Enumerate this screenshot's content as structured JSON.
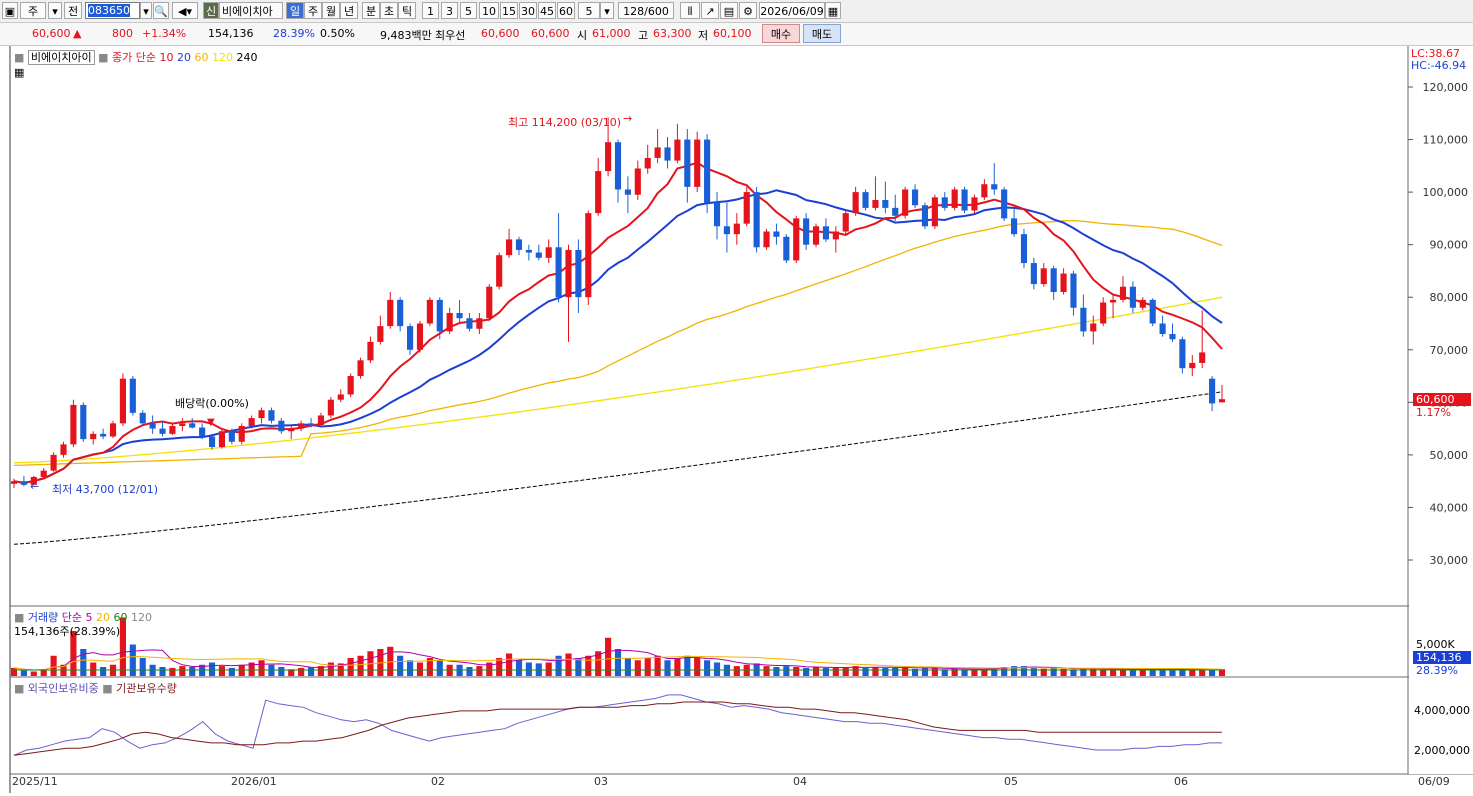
{
  "toolbar": {
    "type_label": "주",
    "market_label": "전",
    "code": "083650",
    "stock_badge": "신",
    "stock_name": "비에이치아",
    "periods": [
      "일",
      "주",
      "월",
      "년",
      "분",
      "초",
      "틱"
    ],
    "minute_options": [
      "1",
      "3",
      "5",
      "10",
      "15",
      "30",
      "45",
      "60"
    ],
    "count_select": "5",
    "bar_count": "128/600",
    "date": "2026/06/09"
  },
  "quote": {
    "price": "60,600",
    "change": "800",
    "change_pct": "+1.34%",
    "volume": "154,136",
    "turnover_pct": "28.39%",
    "ratio": "0.50%",
    "amount": "9,483백만",
    "bid_label": "최우선",
    "bid1": "60,600",
    "bid2": "60,600",
    "open_label": "시",
    "open": "61,000",
    "high_label": "고",
    "high": "63,300",
    "low_label": "저",
    "low": "60,100",
    "buy_label": "매수",
    "sell_label": "매도"
  },
  "price_legend": {
    "name": "비에이치아이",
    "title": "종가 단순",
    "ma": [
      "10",
      "20",
      "60",
      "120",
      "240"
    ],
    "ma_colors": [
      "#e4131c",
      "#1b3fd2",
      "#f0b400",
      "#f5e100",
      "#000000"
    ]
  },
  "right_info": {
    "lc": "LC:38.67",
    "hc": "HC:-46.94"
  },
  "annotations": {
    "high": "최고 114,200 (03/10)",
    "low": "최저 43,700 (12/01)",
    "dividend": "배당락(0.00%)"
  },
  "price_axis": [
    "120,000",
    "110,000",
    "100,000",
    "90,000",
    "80,000",
    "70,000",
    "60,000",
    "50,000",
    "40,000",
    "30,000"
  ],
  "current_tag": {
    "price": "60,600",
    "pct": "1.17%"
  },
  "volume_legend": {
    "title": "거래량",
    "ma_title": "단순",
    "ma": [
      "5",
      "20",
      "60",
      "120"
    ],
    "value": "154,136주(28.39%)"
  },
  "volume_axis": {
    "label": "5,000K",
    "current": "154,136",
    "pct": "28.39%"
  },
  "holding_legend": {
    "a": "외국인보유비중",
    "b": "기관보유수량"
  },
  "holding_axis": [
    "4,000,000",
    "2,000,000"
  ],
  "x_axis": [
    "2025/11",
    "2026/01",
    "02",
    "03",
    "04",
    "05",
    "06",
    "06/09"
  ],
  "chart_data": {
    "type": "candlestick",
    "ylim": [
      25000,
      125000
    ],
    "candles": [
      [
        44500,
        45500,
        43700,
        45000
      ],
      [
        45000,
        46000,
        44000,
        44300
      ],
      [
        44300,
        46000,
        44200,
        45800
      ],
      [
        45800,
        47500,
        45500,
        47000
      ],
      [
        47000,
        50500,
        46800,
        50000
      ],
      [
        50000,
        52500,
        49500,
        52000
      ],
      [
        52000,
        60500,
        51500,
        59500
      ],
      [
        59500,
        60000,
        52500,
        53000
      ],
      [
        53000,
        54500,
        52000,
        54000
      ],
      [
        54000,
        55000,
        53000,
        53500
      ],
      [
        53500,
        56500,
        53200,
        56000
      ],
      [
        56000,
        65500,
        55500,
        64500
      ],
      [
        64500,
        65000,
        57500,
        58000
      ],
      [
        58000,
        58500,
        55500,
        56000
      ],
      [
        56000,
        57500,
        54000,
        55000
      ],
      [
        55000,
        56500,
        53500,
        54000
      ],
      [
        54000,
        56000,
        53800,
        55500
      ],
      [
        55500,
        57000,
        54500,
        56000
      ],
      [
        56000,
        57000,
        55000,
        55200
      ],
      [
        55200,
        56000,
        53000,
        53500
      ],
      [
        53500,
        54000,
        51000,
        51500
      ],
      [
        51500,
        55000,
        51200,
        54500
      ],
      [
        54500,
        55000,
        52000,
        52500
      ],
      [
        52500,
        56000,
        52000,
        55500
      ],
      [
        55500,
        57500,
        55000,
        57000
      ],
      [
        57000,
        59000,
        56000,
        58500
      ],
      [
        58500,
        59000,
        56000,
        56500
      ],
      [
        56500,
        57000,
        54000,
        54500
      ],
      [
        54500,
        55500,
        53000,
        55000
      ],
      [
        55000,
        56500,
        54500,
        56000
      ],
      [
        56000,
        57000,
        55200,
        55700
      ],
      [
        55700,
        58000,
        55500,
        57500
      ],
      [
        57500,
        61000,
        57000,
        60500
      ],
      [
        60500,
        62500,
        60000,
        61500
      ],
      [
        61500,
        65500,
        61000,
        65000
      ],
      [
        65000,
        68500,
        64500,
        68000
      ],
      [
        68000,
        72500,
        67500,
        71500
      ],
      [
        71500,
        76500,
        71000,
        74500
      ],
      [
        74500,
        81000,
        74000,
        79500
      ],
      [
        79500,
        80000,
        73500,
        74500
      ],
      [
        74500,
        75000,
        69000,
        70000
      ],
      [
        70000,
        75500,
        69500,
        75000
      ],
      [
        75000,
        80000,
        74500,
        79500
      ],
      [
        79500,
        80000,
        72000,
        73500
      ],
      [
        73500,
        78000,
        73000,
        77000
      ],
      [
        77000,
        79500,
        75000,
        76000
      ],
      [
        76000,
        77000,
        73500,
        74000
      ],
      [
        74000,
        77000,
        73000,
        76000
      ],
      [
        76000,
        82500,
        75500,
        82000
      ],
      [
        82000,
        88500,
        81500,
        88000
      ],
      [
        88000,
        93000,
        87500,
        91000
      ],
      [
        91000,
        91500,
        88000,
        89000
      ],
      [
        89000,
        90000,
        87000,
        88500
      ],
      [
        88500,
        90000,
        87000,
        87500
      ],
      [
        87500,
        91000,
        86500,
        89500
      ],
      [
        89500,
        96000,
        79000,
        80000
      ],
      [
        80000,
        90000,
        71500,
        89000
      ],
      [
        89000,
        91000,
        77000,
        80000
      ],
      [
        80000,
        96500,
        78500,
        96000
      ],
      [
        96000,
        106500,
        95500,
        104000
      ],
      [
        104000,
        114200,
        103000,
        109500
      ],
      [
        109500,
        110000,
        98000,
        100500
      ],
      [
        100500,
        103000,
        96000,
        99500
      ],
      [
        99500,
        106000,
        98500,
        104500
      ],
      [
        104500,
        109000,
        103500,
        106500
      ],
      [
        106500,
        112000,
        105500,
        108500
      ],
      [
        108500,
        110500,
        104500,
        106000
      ],
      [
        106000,
        113000,
        105500,
        110000
      ],
      [
        110000,
        112000,
        98000,
        101000
      ],
      [
        101000,
        111500,
        100000,
        110000
      ],
      [
        110000,
        111000,
        96000,
        98000
      ],
      [
        98000,
        100000,
        91000,
        93500
      ],
      [
        93500,
        98000,
        88500,
        92000
      ],
      [
        92000,
        96000,
        90000,
        94000
      ],
      [
        94000,
        101000,
        93500,
        100000
      ],
      [
        100000,
        101000,
        88500,
        89500
      ],
      [
        89500,
        93000,
        89000,
        92500
      ],
      [
        92500,
        94000,
        90000,
        91500
      ],
      [
        91500,
        92000,
        86500,
        87000
      ],
      [
        87000,
        95500,
        86500,
        95000
      ],
      [
        95000,
        96000,
        89000,
        90000
      ],
      [
        90000,
        94000,
        89500,
        93500
      ],
      [
        93500,
        95000,
        90500,
        91000
      ],
      [
        91000,
        93500,
        88500,
        92500
      ],
      [
        92500,
        96500,
        92000,
        96000
      ],
      [
        96000,
        101000,
        95500,
        100000
      ],
      [
        100000,
        100500,
        96500,
        97000
      ],
      [
        97000,
        103000,
        96500,
        98500
      ],
      [
        98500,
        102000,
        96000,
        97000
      ],
      [
        97000,
        99500,
        94500,
        95500
      ],
      [
        95500,
        101000,
        95000,
        100500
      ],
      [
        100500,
        101500,
        97000,
        97500
      ],
      [
        97500,
        98000,
        93000,
        93500
      ],
      [
        93500,
        99500,
        93000,
        99000
      ],
      [
        99000,
        100000,
        96500,
        97000
      ],
      [
        97000,
        101000,
        96500,
        100500
      ],
      [
        100500,
        101000,
        96000,
        96500
      ],
      [
        96500,
        99500,
        96000,
        99000
      ],
      [
        99000,
        102500,
        98500,
        101500
      ],
      [
        101500,
        105500,
        99500,
        100500
      ],
      [
        100500,
        101000,
        94500,
        95000
      ],
      [
        95000,
        97000,
        91500,
        92000
      ],
      [
        92000,
        93000,
        85500,
        86500
      ],
      [
        86500,
        87500,
        81500,
        82500
      ],
      [
        82500,
        86500,
        82000,
        85500
      ],
      [
        85500,
        86000,
        79500,
        81000
      ],
      [
        81000,
        85500,
        80500,
        84500
      ],
      [
        84500,
        85000,
        76500,
        78000
      ],
      [
        78000,
        80500,
        72500,
        73500
      ],
      [
        73500,
        76500,
        71000,
        75000
      ],
      [
        75000,
        80000,
        74500,
        79000
      ],
      [
        79000,
        80500,
        76000,
        79500
      ],
      [
        79500,
        84000,
        79000,
        82000
      ],
      [
        82000,
        83000,
        77000,
        78000
      ],
      [
        78000,
        80000,
        77500,
        79500
      ],
      [
        79500,
        79800,
        74500,
        75000
      ],
      [
        75000,
        76500,
        72500,
        73000
      ],
      [
        73000,
        75000,
        71500,
        72000
      ],
      [
        72000,
        72500,
        65500,
        66500
      ],
      [
        66500,
        69000,
        65000,
        67500
      ],
      [
        67500,
        77500,
        66500,
        69500
      ],
      [
        64500,
        65000,
        58300,
        59800
      ],
      [
        60000,
        63300,
        60000,
        60600
      ]
    ],
    "volume": [
      0.18,
      0.12,
      0.1,
      0.15,
      0.45,
      0.25,
      1.0,
      0.6,
      0.3,
      0.2,
      0.25,
      1.3,
      0.7,
      0.4,
      0.25,
      0.2,
      0.18,
      0.22,
      0.2,
      0.25,
      0.3,
      0.22,
      0.18,
      0.25,
      0.3,
      0.35,
      0.25,
      0.2,
      0.15,
      0.18,
      0.2,
      0.22,
      0.3,
      0.28,
      0.4,
      0.45,
      0.55,
      0.6,
      0.65,
      0.45,
      0.35,
      0.3,
      0.4,
      0.35,
      0.25,
      0.25,
      0.2,
      0.22,
      0.3,
      0.4,
      0.5,
      0.35,
      0.3,
      0.28,
      0.3,
      0.45,
      0.5,
      0.4,
      0.45,
      0.55,
      0.85,
      0.6,
      0.4,
      0.35,
      0.4,
      0.45,
      0.35,
      0.4,
      0.45,
      0.4,
      0.35,
      0.3,
      0.25,
      0.22,
      0.25,
      0.28,
      0.22,
      0.2,
      0.22,
      0.2,
      0.18,
      0.2,
      0.18,
      0.18,
      0.2,
      0.22,
      0.18,
      0.2,
      0.18,
      0.18,
      0.2,
      0.16,
      0.18,
      0.17,
      0.15,
      0.16,
      0.15,
      0.15,
      0.16,
      0.18,
      0.2,
      0.22,
      0.22,
      0.18,
      0.16,
      0.18,
      0.16,
      0.15,
      0.17,
      0.16,
      0.15,
      0.16,
      0.14,
      0.15,
      0.15,
      0.14,
      0.16,
      0.15,
      0.14,
      0.13,
      0.14,
      0.14,
      0.15,
      0.12,
      0.12
    ],
    "ma10": [],
    "holding_series_a": [
      1.6,
      1.9,
      2.0,
      2.2,
      2.4,
      2.5,
      2.6,
      3.1,
      2.9,
      2.4,
      2.0,
      2.2,
      2.3,
      2.6,
      3.0,
      3.5,
      2.8,
      2.4,
      2.2,
      2.0,
      4.7,
      4.5,
      4.4,
      4.3,
      4.0,
      3.8,
      3.6,
      3.5,
      3.6,
      3.4,
      3.0,
      2.8,
      2.6,
      2.4,
      2.6,
      2.7,
      2.8,
      2.9,
      3.0,
      3.1,
      3.4,
      3.6,
      3.8,
      4.0,
      4.2,
      4.3,
      4.3,
      4.4,
      4.5,
      4.6,
      4.7,
      4.8,
      5.0,
      5.0,
      4.8,
      4.6,
      4.5,
      4.3,
      4.4,
      4.3,
      4.2,
      4.0,
      3.9,
      3.8,
      3.7,
      3.6,
      3.5,
      3.5,
      3.4,
      3.4,
      3.3,
      3.2,
      3.1,
      3.0,
      2.9,
      2.8,
      2.7,
      2.6,
      2.6,
      2.5,
      2.5,
      2.4,
      2.3,
      2.2,
      2.1,
      2.0,
      1.9,
      1.9,
      1.9,
      2.0,
      2.0,
      2.1,
      2.1,
      2.2,
      2.2,
      2.3,
      2.3
    ],
    "holding_series_b": [
      1.6,
      1.7,
      1.8,
      1.9,
      2.0,
      2.0,
      2.1,
      2.3,
      2.5,
      2.8,
      2.9,
      2.8,
      2.6,
      2.5,
      2.4,
      2.3,
      2.3,
      2.2,
      2.2,
      2.2,
      2.3,
      2.3,
      2.4,
      2.4,
      2.5,
      2.6,
      2.8,
      3.0,
      3.3,
      3.5,
      3.7,
      3.8,
      3.9,
      4.0,
      4.1,
      4.1,
      4.1,
      4.2,
      4.2,
      4.2,
      4.2,
      4.2,
      4.2,
      4.3,
      4.3,
      4.3,
      4.3,
      4.4,
      4.4,
      4.5,
      4.5,
      4.6,
      4.6,
      4.6,
      4.6,
      4.5,
      4.5,
      4.4,
      4.3,
      4.3,
      4.2,
      4.2,
      4.1,
      4.0,
      4.0,
      3.9,
      3.8,
      3.7,
      3.6,
      3.4,
      3.2,
      3.1,
      3.0,
      3.0,
      3.0,
      3.0,
      3.0,
      3.0,
      2.9,
      2.9,
      2.9,
      2.9,
      2.9,
      2.9,
      2.9,
      2.9,
      2.9,
      2.9,
      2.9,
      2.9,
      2.9,
      2.9,
      2.9
    ]
  }
}
